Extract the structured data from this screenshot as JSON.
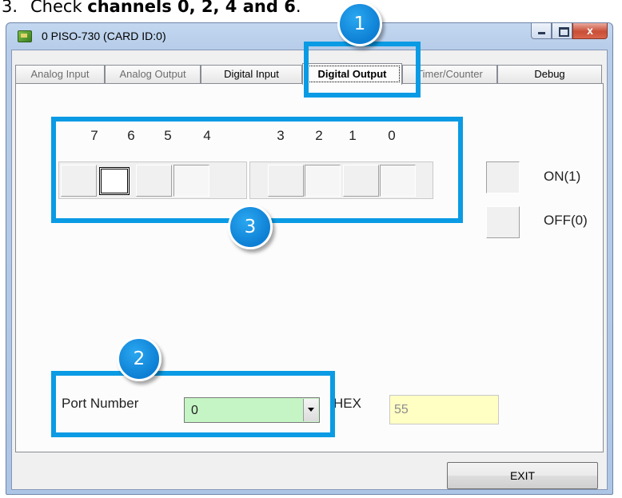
{
  "doc": {
    "step_number": "3.",
    "instruction_prefix": "Check ",
    "instruction_bold": "channels 0, 2, 4 and 6",
    "instruction_suffix": "."
  },
  "window": {
    "title": "0 PISO-730 (CARD ID:0)",
    "close_glyph": "x"
  },
  "tabs": [
    {
      "label": "Analog Input",
      "state": "disabled"
    },
    {
      "label": "Analog Output",
      "state": "disabled"
    },
    {
      "label": "Digital Input",
      "state": "normal"
    },
    {
      "label": "Digital Output",
      "state": "active"
    },
    {
      "label": "Timer/Counter",
      "state": "disabled"
    },
    {
      "label": "Debug",
      "state": "normal"
    }
  ],
  "bits": {
    "labels": [
      "7",
      "6",
      "5",
      "4",
      "3",
      "2",
      "1",
      "0"
    ]
  },
  "legend": {
    "on_label": "ON(1)",
    "off_label": "OFF(0)"
  },
  "port": {
    "label": "Port Number",
    "value": "0"
  },
  "hex": {
    "label": "HEX",
    "value": "55"
  },
  "exit_label": "EXIT",
  "callouts": [
    "1",
    "2",
    "3"
  ],
  "colors": {
    "callout_blue": "#0a9be4",
    "combo_green": "#c5f5c5",
    "hex_yellow": "#ffffc4"
  }
}
